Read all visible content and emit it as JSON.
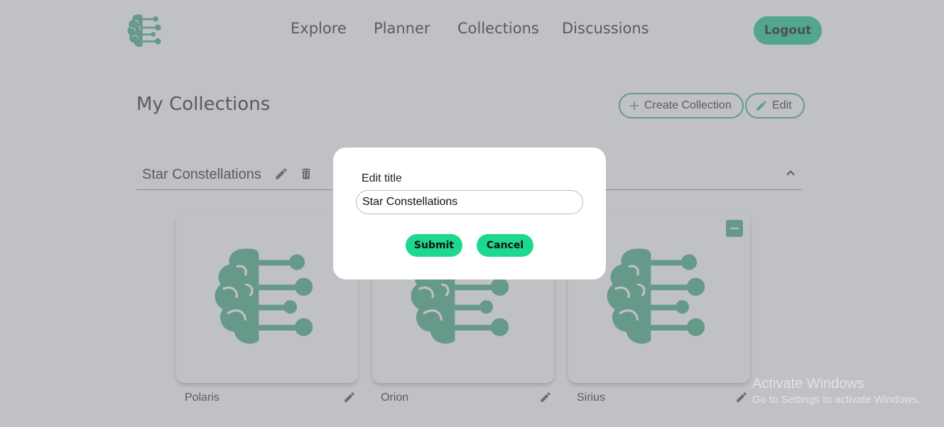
{
  "nav": {
    "links": [
      "Explore",
      "Planner",
      "Collections",
      "Discussions"
    ],
    "logout_label": "Logout"
  },
  "page": {
    "title": "My Collections",
    "create_label": "Create Collection",
    "edit_label": "Edit"
  },
  "collection": {
    "title": "Star Constellations",
    "items": [
      {
        "label": "Polaris"
      },
      {
        "label": "Orion"
      },
      {
        "label": "Sirius"
      }
    ]
  },
  "modal": {
    "label": "Edit title",
    "input_value": "Star Constellations",
    "submit_label": "Submit",
    "cancel_label": "Cancel"
  },
  "watermark": {
    "line1": "Activate Windows",
    "line2": "Go to Settings to activate Windows."
  },
  "icons": {
    "logo": "brain-circuit-icon",
    "edit": "pencil-icon",
    "delete": "trash-icon",
    "collapse": "chevron-up-icon",
    "add": "plus-icon",
    "remove": "minus-icon"
  },
  "colors": {
    "accent": "#4caf86",
    "button": "#22c98a",
    "modal_button": "#1fd890"
  }
}
